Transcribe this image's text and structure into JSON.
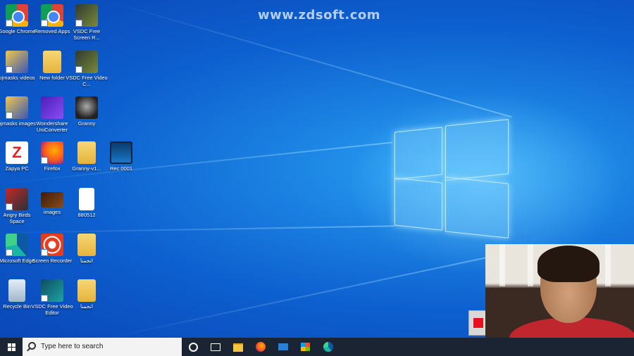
{
  "watermark": "www.zdsoft.com",
  "desktop_icons": [
    {
      "label": "Google Chrome",
      "icon": "chrome-icon"
    },
    {
      "label": "Removed Apps",
      "icon": "chrome-icon"
    },
    {
      "label": "VSDC Free Screen R...",
      "icon": "vsdc-screen-recorder-icon"
    },
    {
      "label": "pjmasks videos",
      "icon": "folder-icon"
    },
    {
      "label": "New folder",
      "icon": "folder-icon"
    },
    {
      "label": "VSDC Free Video C...",
      "icon": "vsdc-video-capture-icon"
    },
    {
      "label": "pjmasks images",
      "icon": "folder-icon"
    },
    {
      "label": "Wondershare UniConverter",
      "icon": "uniconverter-icon"
    },
    {
      "label": "Granny",
      "icon": "granny-game-icon"
    },
    {
      "label": "Zapya PC",
      "icon": "zapya-icon"
    },
    {
      "label": "Firefox",
      "icon": "firefox-icon"
    },
    {
      "label": "Granny-v1...",
      "icon": "folder-icon"
    },
    {
      "label": "Rec 0001",
      "icon": "video-file-icon"
    },
    {
      "label": "Angry Birds Space",
      "icon": "angry-birds-icon"
    },
    {
      "label": "images",
      "icon": "image-file-icon"
    },
    {
      "label": "880512",
      "icon": "document-icon"
    },
    {
      "label": "Microsoft Edge",
      "icon": "edge-icon"
    },
    {
      "label": "Screen Recorder",
      "icon": "screen-recorder-icon"
    },
    {
      "label": "انجمنا",
      "icon": "folder-icon"
    },
    {
      "label": "Recycle Bin",
      "icon": "recycle-bin-icon"
    },
    {
      "label": "VSDC Free Video Editor",
      "icon": "vsdc-video-editor-icon"
    },
    {
      "label": "انجمنا",
      "icon": "folder-icon"
    }
  ],
  "taskbar": {
    "search_placeholder": "Type here to search",
    "pinned": [
      "cortana-icon",
      "task-view-icon",
      "file-explorer-icon",
      "firefox-icon",
      "mail-icon",
      "store-icon",
      "edge-icon"
    ]
  },
  "recording": {
    "stop_icon": "stop-recording-icon",
    "stop_color": "#e8101e"
  },
  "colors": {
    "taskbar": "#1a2433",
    "desktop_accent": "#1a7fe0"
  }
}
